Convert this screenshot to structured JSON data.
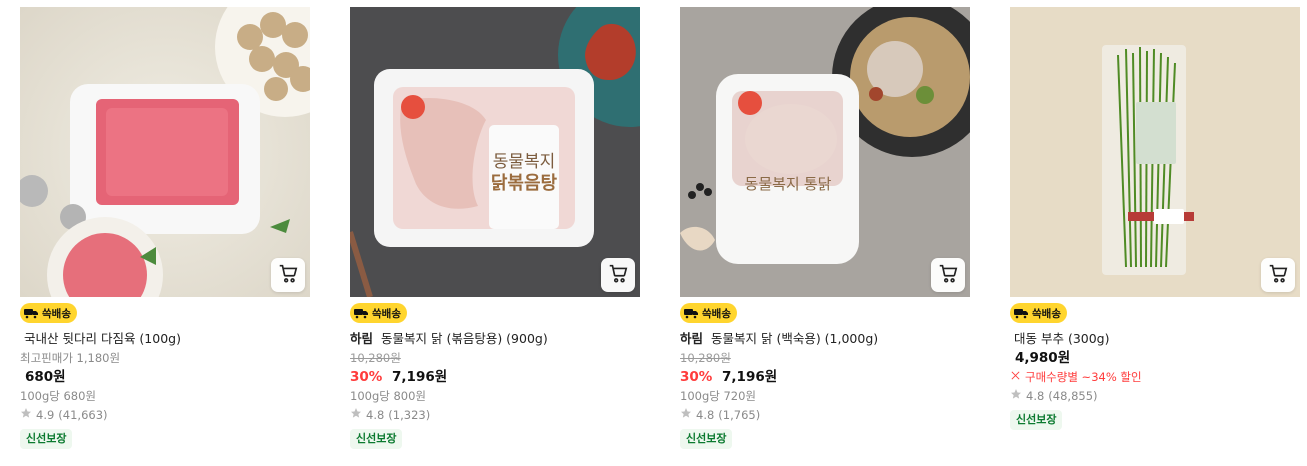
{
  "products": [
    {
      "delivery_badge": "쓱배송",
      "brand": "",
      "title": "국내산 뒷다리 다짐육 (100g)",
      "sub_price": "최고핀매가 1,180원",
      "discount": "",
      "price": "680원",
      "unit_price": "100g당 680원",
      "promo": "",
      "rating": "4.9",
      "review_count": "(41,663)",
      "fresh_label": "신선보장"
    },
    {
      "delivery_badge": "쓱배송",
      "brand": "하림",
      "title": "동물복지 닭 (볶음탕용) (900g)",
      "sub_price": "10,280원",
      "discount": "30%",
      "price": "7,196원",
      "unit_price": "100g당 800원",
      "promo": "",
      "rating": "4.8",
      "review_count": "(1,323)",
      "fresh_label": "신선보장",
      "package_text": "동물복지\n닭볶음탕용"
    },
    {
      "delivery_badge": "쓱배송",
      "brand": "하림",
      "title": "동물복지 닭 (백숙용) (1,000g)",
      "sub_price": "10,280원",
      "discount": "30%",
      "price": "7,196원",
      "unit_price": "100g당 720원",
      "promo": "",
      "rating": "4.8",
      "review_count": "(1,765)",
      "fresh_label": "신선보장",
      "package_text": "동물복지 통닭"
    },
    {
      "delivery_badge": "쓱배송",
      "brand": "",
      "title": "대동 부추 (300g)",
      "sub_price": "",
      "discount": "",
      "price": "4,980원",
      "unit_price": "",
      "promo": "구매수량별 ~34% 할인",
      "rating": "4.8",
      "review_count": "(48,855)",
      "fresh_label": "신선보장"
    }
  ],
  "icons": {
    "cart": "cart-icon",
    "truck": "delivery-truck-icon",
    "star": "star-icon",
    "coupon": "coupon-icon"
  },
  "colors": {
    "badge_bg": "#ffd52e",
    "discount_red": "#ff3c3c",
    "fresh_green": "#0b7a2f"
  }
}
